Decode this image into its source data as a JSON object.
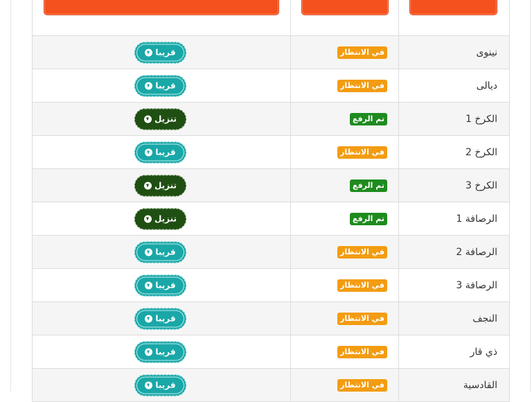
{
  "rows": [
    {
      "name": "نينوى",
      "status": "في الانتظار",
      "status_type": "wait",
      "action": "قريبا",
      "action_type": "soon"
    },
    {
      "name": "ديالى",
      "status": "في الانتظار",
      "status_type": "wait",
      "action": "قريبا",
      "action_type": "soon"
    },
    {
      "name": "الكرخ 1",
      "status": "تم الرفع",
      "status_type": "done",
      "action": "تنزيل",
      "action_type": "dl"
    },
    {
      "name": "الكرخ 2",
      "status": "في الانتظار",
      "status_type": "wait",
      "action": "قريبا",
      "action_type": "soon"
    },
    {
      "name": "الكرخ 3",
      "status": "تم الرفع",
      "status_type": "done",
      "action": "تنزيل",
      "action_type": "dl"
    },
    {
      "name": "الرصافة 1",
      "status": "تم الرفع",
      "status_type": "done",
      "action": "تنزيل",
      "action_type": "dl"
    },
    {
      "name": "الرصافة 2",
      "status": "في الانتظار",
      "status_type": "wait",
      "action": "قريبا",
      "action_type": "soon"
    },
    {
      "name": "الرصافة 3",
      "status": "في الانتظار",
      "status_type": "wait",
      "action": "قريبا",
      "action_type": "soon"
    },
    {
      "name": "النجف",
      "status": "في الانتظار",
      "status_type": "wait",
      "action": "قريبا",
      "action_type": "soon"
    },
    {
      "name": "ذي قار",
      "status": "في الانتظار",
      "status_type": "wait",
      "action": "قريبا",
      "action_type": "soon"
    },
    {
      "name": "القادسية",
      "status": "في الانتظار",
      "status_type": "wait",
      "action": "قريبا",
      "action_type": "soon"
    }
  ],
  "colors": {
    "header_button": "#f4511e",
    "status_wait": "#f39c12",
    "status_done": "#1e8b1e",
    "action_soon": "#1aa7a7",
    "action_download": "#1f4f12"
  },
  "icons": {
    "action": "arrow-circle-down-icon"
  }
}
